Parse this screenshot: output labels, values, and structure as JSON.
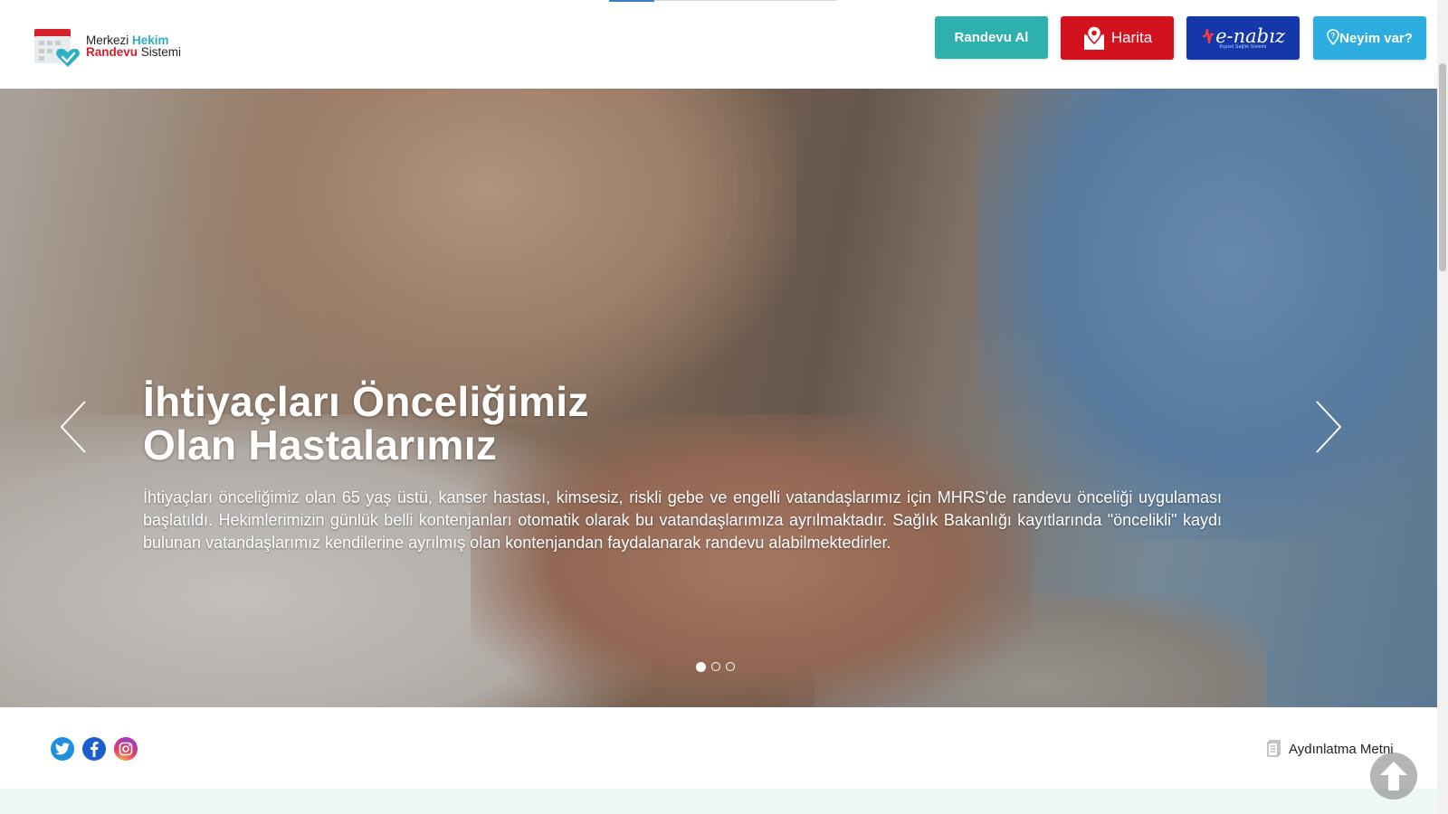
{
  "header": {
    "logo": {
      "line1_a": "Merkezi",
      "line1_b": "Hekim",
      "line2_a": "Randevu",
      "line2_b": "Sistemi"
    },
    "buttons": {
      "randevu": "Randevu Al",
      "harita": "Harita",
      "enabiz": "e-nabız",
      "enabiz_sub": "Kişisel Sağlık Sistemi",
      "neyim": "Neyim var?"
    }
  },
  "slider": {
    "title_line1": "İhtiyaçları Önceliğimiz",
    "title_line2": "Olan Hastalarımız",
    "description": "İhtiyaçları önceliğimiz olan 65 yaş üstü, kanser hastası, kimsesiz, riskli gebe ve engelli vatandaşlarımız için MHRS'de randevu önceliği uygulaması başlatıldı. Hekimlerimizin günlük belli kontenjanları otomatik olarak bu vatandaşlarımıza ayrılmaktadır. Sağlık Bakanlığı kayıtlarında \"öncelikli\" kaydı bulunan vatandaşlarımız kendilerine ayrılmış olan kontenjandan faydalanarak randevu alabilmektedirler.",
    "slide_count": 3,
    "active_slide": 1
  },
  "footer": {
    "social": [
      "twitter-icon",
      "facebook-icon",
      "instagram-icon"
    ],
    "aydinlatma": "Aydınlatma Metni"
  },
  "colors": {
    "randevu": "#2eb0ac",
    "harita": "#d2131e",
    "enabiz": "#1438a9",
    "neyim": "#2eaee0",
    "brand_teal": "#2cb1c4",
    "brand_red": "#d5202a"
  }
}
